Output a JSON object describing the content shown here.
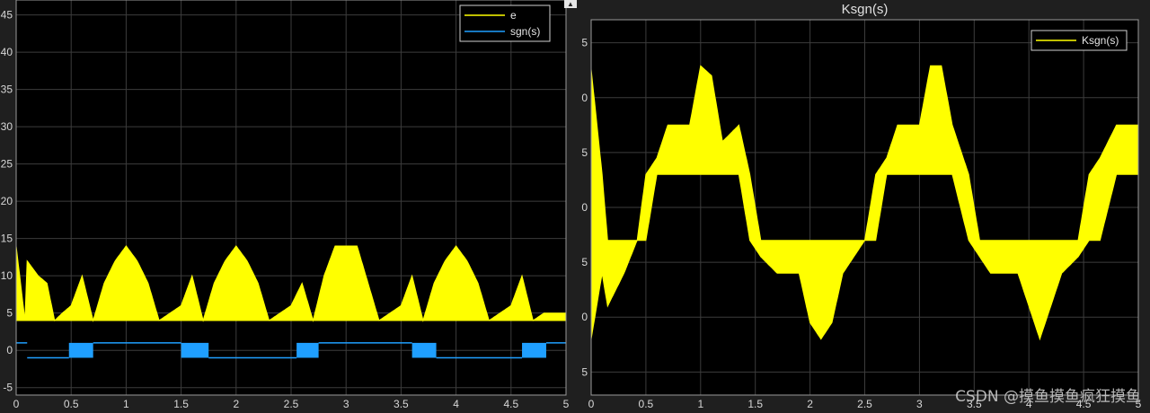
{
  "chart_data": [
    {
      "type": "line",
      "title": "",
      "xlim": [
        0,
        5
      ],
      "ylim": [
        -6,
        47
      ],
      "xticks": [
        "0",
        "0.5",
        "1",
        "1.5",
        "2",
        "2.5",
        "3",
        "3.5",
        "4",
        "4.5",
        "5"
      ],
      "yticks": [
        "-5",
        "0",
        "5",
        "10",
        "15",
        "20",
        "25",
        "30",
        "35",
        "40",
        "45"
      ],
      "grid": true,
      "legend": "top-right",
      "series": [
        {
          "name": "e",
          "color": "#ffff00",
          "style": "chattering-band",
          "x": [
            0,
            0.08,
            0.1,
            0.2,
            0.28,
            0.35,
            0.42,
            0.5,
            0.6,
            0.7,
            0.8,
            0.9,
            1.0,
            1.1,
            1.2,
            1.3,
            1.4,
            1.5,
            1.6,
            1.7,
            1.8,
            1.9,
            2.0,
            2.1,
            2.2,
            2.3,
            2.4,
            2.5,
            2.6,
            2.7,
            2.8,
            2.9,
            3.0,
            3.1,
            3.2,
            3.3,
            3.4,
            3.5,
            3.6,
            3.7,
            3.8,
            3.9,
            4.0,
            4.1,
            4.2,
            4.3,
            4.4,
            4.5,
            4.6,
            4.7,
            4.8,
            4.9,
            5.0
          ],
          "upper": [
            14,
            4,
            12,
            10,
            9,
            4,
            5,
            6,
            10,
            4,
            9,
            12,
            14,
            12,
            9,
            4,
            5,
            6,
            10,
            4,
            9,
            12,
            14,
            12,
            9,
            4,
            5,
            6,
            9,
            4,
            10,
            14,
            14,
            14,
            9,
            4,
            5,
            6,
            10,
            4,
            9,
            12,
            14,
            12,
            9,
            4,
            5,
            6,
            10,
            4,
            5,
            5,
            5
          ],
          "lower": [
            4,
            4,
            4,
            4,
            4,
            4,
            4,
            4,
            4,
            4,
            4,
            4,
            4,
            4,
            4,
            4,
            4,
            4,
            4,
            4,
            4,
            4,
            4,
            4,
            4,
            4,
            4,
            4,
            4,
            4,
            4,
            4,
            4,
            4,
            4,
            4,
            4,
            4,
            4,
            4,
            4,
            4,
            4,
            4,
            4,
            4,
            4,
            4,
            4,
            4,
            4,
            4,
            4
          ]
        },
        {
          "name": "sgn(s)",
          "color": "#1f9fff",
          "style": "switching",
          "levels": [
            -1,
            1
          ],
          "segments": [
            [
              0,
              0.1,
              1
            ],
            [
              0.1,
              0.48,
              -1
            ],
            [
              0.48,
              0.7,
              "chatter"
            ],
            [
              0.7,
              1.5,
              1
            ],
            [
              1.5,
              1.75,
              "chatter"
            ],
            [
              1.75,
              2.55,
              -1
            ],
            [
              2.55,
              2.75,
              "chatter"
            ],
            [
              2.75,
              3.6,
              1
            ],
            [
              3.6,
              3.82,
              "chatter"
            ],
            [
              3.82,
              4.6,
              -1
            ],
            [
              4.6,
              4.82,
              "chatter"
            ],
            [
              4.82,
              5.0,
              1
            ]
          ]
        }
      ]
    },
    {
      "type": "line",
      "title": "Ksgn(s)",
      "xlim": [
        0,
        5
      ],
      "ylim": [
        -57,
        57
      ],
      "xticks": [
        "0",
        "0.5",
        "1",
        "1.5",
        "2",
        "2.5",
        "3",
        "3.5",
        "4",
        "4.5",
        "5"
      ],
      "yticks": [
        "5",
        "0",
        "5",
        "0",
        "5",
        "0",
        "5"
      ],
      "grid": true,
      "legend": "top-right",
      "series": [
        {
          "name": "Ksgn(s)",
          "color": "#ffff00",
          "style": "chattering-band",
          "x": [
            0,
            0.1,
            0.15,
            0.3,
            0.42,
            0.5,
            0.6,
            0.7,
            0.8,
            0.9,
            1.0,
            1.1,
            1.2,
            1.35,
            1.45,
            1.55,
            1.7,
            1.8,
            1.9,
            2.0,
            2.1,
            2.2,
            2.3,
            2.4,
            2.5,
            2.6,
            2.7,
            2.8,
            2.9,
            3.0,
            3.1,
            3.2,
            3.3,
            3.45,
            3.55,
            3.65,
            3.8,
            3.9,
            4.0,
            4.1,
            4.2,
            4.3,
            4.45,
            4.55,
            4.65,
            4.8,
            5.0
          ],
          "upper": [
            42,
            10,
            -10,
            -10,
            -10,
            10,
            15,
            25,
            25,
            25,
            43,
            40,
            20,
            25,
            10,
            -10,
            -10,
            -10,
            -10,
            -10,
            -10,
            -10,
            -10,
            -10,
            -10,
            10,
            15,
            25,
            25,
            25,
            43,
            43,
            25,
            10,
            -10,
            -10,
            -10,
            -10,
            -10,
            -10,
            -10,
            -10,
            -10,
            10,
            15,
            25,
            25
          ],
          "lower": [
            -40,
            -20,
            -30,
            -20,
            -10,
            -10,
            10,
            10,
            10,
            10,
            10,
            10,
            10,
            10,
            -10,
            -15,
            -20,
            -20,
            -20,
            -35,
            -40,
            -35,
            -20,
            -15,
            -10,
            -10,
            10,
            10,
            10,
            10,
            10,
            10,
            10,
            -10,
            -15,
            -20,
            -20,
            -20,
            -30,
            -40,
            -30,
            -20,
            -15,
            -10,
            -10,
            10,
            10
          ]
        }
      ]
    }
  ],
  "watermark": "CSDN @摸鱼摸鱼疯狂摸鱼"
}
